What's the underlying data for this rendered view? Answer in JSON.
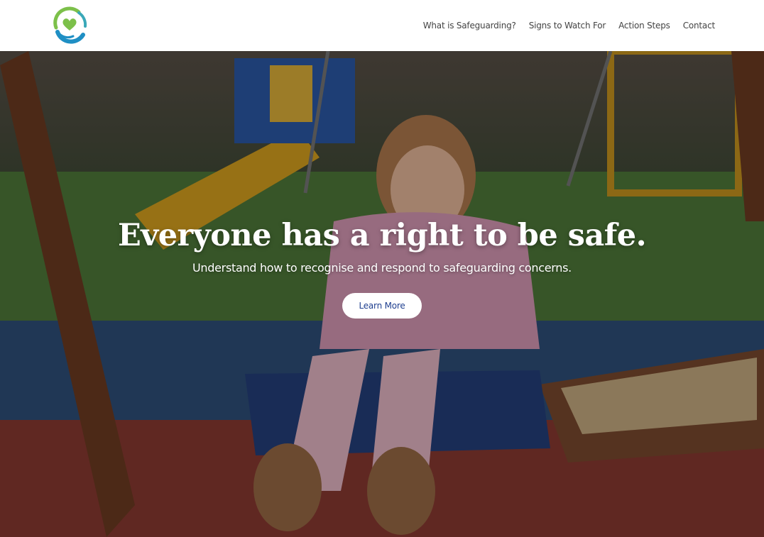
{
  "header": {
    "logo_icon": "heart-in-hands-icon",
    "nav": [
      {
        "label": "What is Safeguarding?"
      },
      {
        "label": "Signs to Watch For"
      },
      {
        "label": "Action Steps"
      },
      {
        "label": "Contact"
      }
    ]
  },
  "hero": {
    "background_image": "girl-on-swing-playground-photo",
    "title": "Everyone has a right to be safe.",
    "subtitle": "Understand how to recognise and respond to safeguarding concerns.",
    "cta_label": "Learn More"
  },
  "colors": {
    "logo_blue": "#1f8fc4",
    "logo_green": "#7cc04a",
    "cta_text": "#1f3f8f",
    "nav_text": "#444444"
  }
}
